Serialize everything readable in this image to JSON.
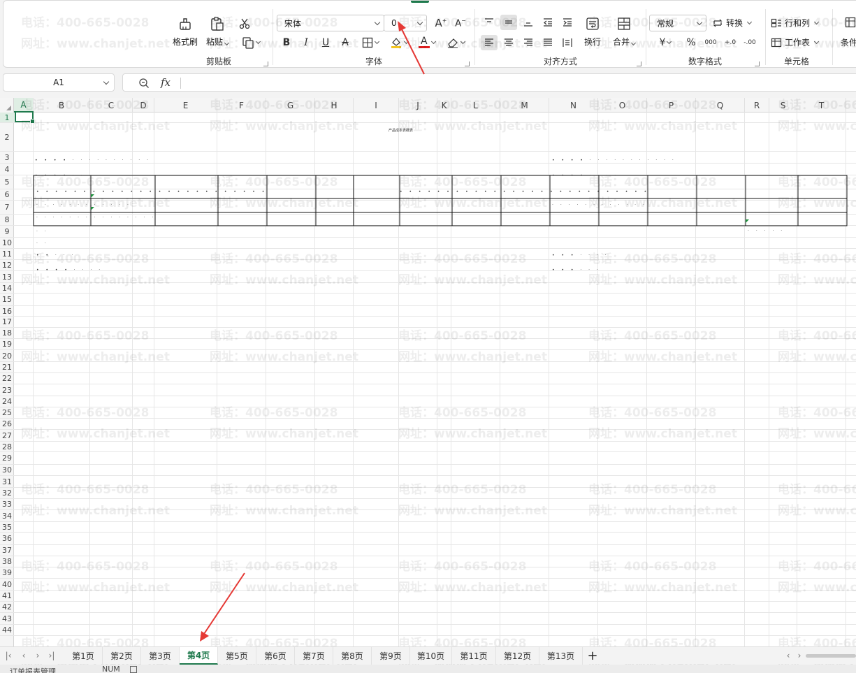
{
  "ribbon": {
    "clipboard": {
      "group_label": "剪贴板",
      "format_painter": "格式刷",
      "paste": "粘贴"
    },
    "font": {
      "group_label": "字体",
      "font_name": "宋体",
      "font_size": "0",
      "bold": "B",
      "italic": "I",
      "underline": "U",
      "strike": "A",
      "font_color_glyph": "A"
    },
    "alignment": {
      "group_label": "对齐方式",
      "wrap": "换行",
      "merge": "合并"
    },
    "number": {
      "group_label": "数字格式",
      "format": "常规",
      "convert": "转换",
      "currency": "¥",
      "percent": "%",
      "thousands": "000",
      "inc_decimal": "+.0",
      "dec_decimal": "-.00"
    },
    "cells": {
      "group_label": "单元格",
      "rows_cols": "行和列",
      "worksheet": "工作表"
    },
    "cond": {
      "label": "条件"
    }
  },
  "formula_bar": {
    "name_box": "A1",
    "fx": "fx",
    "content": ""
  },
  "grid": {
    "columns": [
      "A",
      "B",
      "C",
      "D",
      "E",
      "F",
      "G",
      "H",
      "I",
      "J",
      "K",
      "L",
      "M",
      "N",
      "O",
      "P",
      "Q",
      "R",
      "S",
      "T"
    ],
    "rows": [
      "1",
      "2",
      "3",
      "4",
      "5",
      "6",
      "7",
      "8",
      "9",
      "10",
      "11",
      "12",
      "13",
      "14",
      "15",
      "16",
      "17",
      "18",
      "19",
      "20",
      "21",
      "22",
      "23",
      "24",
      "25",
      "26",
      "27",
      "28",
      "29",
      "30",
      "31",
      "32",
      "33",
      "34",
      "35",
      "36",
      "37",
      "38",
      "39",
      "40",
      "41",
      "42",
      "43",
      "44"
    ],
    "selected_column": "A",
    "selected_row": "1",
    "report_title": "产品成本表概表"
  },
  "watermark": {
    "phone": "电话：400-665-0028",
    "site": "网址：www.chanjet.net"
  },
  "tabs": [
    "第1页",
    "第2页",
    "第3页",
    "第4页",
    "第5页",
    "第6页",
    "第7页",
    "第8页",
    "第9页",
    "第10页",
    "第11页",
    "第12页",
    "第13页"
  ],
  "active_tab": "第4页",
  "add_tab": "+",
  "status": {
    "workbook": "订单报表管理",
    "mode": "NUM"
  },
  "colors": {
    "accent": "#1f7a4d",
    "annotation_arrow": "#e53935",
    "font_color_bar": "#e02020",
    "fill_color_bar": "#f3c623"
  }
}
